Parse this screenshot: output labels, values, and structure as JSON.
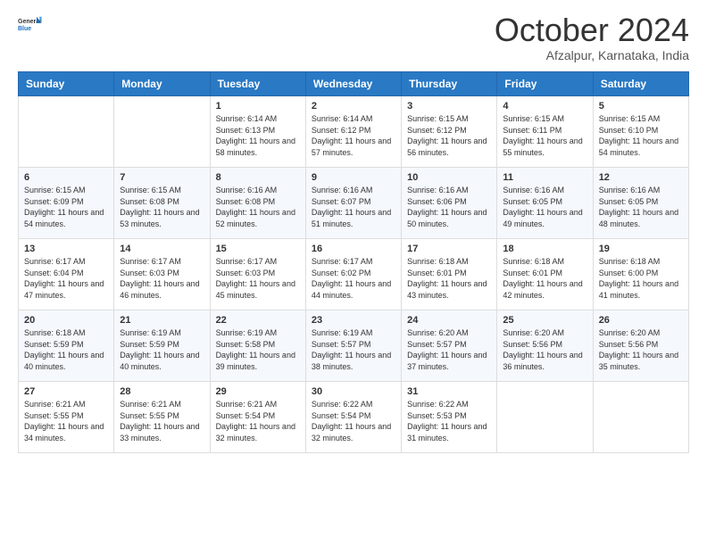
{
  "header": {
    "logo": {
      "general": "General",
      "blue": "Blue"
    },
    "title": "October 2024",
    "location": "Afzalpur, Karnataka, India"
  },
  "calendar": {
    "weekdays": [
      "Sunday",
      "Monday",
      "Tuesday",
      "Wednesday",
      "Thursday",
      "Friday",
      "Saturday"
    ],
    "weeks": [
      [
        {
          "day": "",
          "info": ""
        },
        {
          "day": "",
          "info": ""
        },
        {
          "day": "1",
          "info": "Sunrise: 6:14 AM\nSunset: 6:13 PM\nDaylight: 11 hours and 58 minutes."
        },
        {
          "day": "2",
          "info": "Sunrise: 6:14 AM\nSunset: 6:12 PM\nDaylight: 11 hours and 57 minutes."
        },
        {
          "day": "3",
          "info": "Sunrise: 6:15 AM\nSunset: 6:12 PM\nDaylight: 11 hours and 56 minutes."
        },
        {
          "day": "4",
          "info": "Sunrise: 6:15 AM\nSunset: 6:11 PM\nDaylight: 11 hours and 55 minutes."
        },
        {
          "day": "5",
          "info": "Sunrise: 6:15 AM\nSunset: 6:10 PM\nDaylight: 11 hours and 54 minutes."
        }
      ],
      [
        {
          "day": "6",
          "info": "Sunrise: 6:15 AM\nSunset: 6:09 PM\nDaylight: 11 hours and 54 minutes."
        },
        {
          "day": "7",
          "info": "Sunrise: 6:15 AM\nSunset: 6:08 PM\nDaylight: 11 hours and 53 minutes."
        },
        {
          "day": "8",
          "info": "Sunrise: 6:16 AM\nSunset: 6:08 PM\nDaylight: 11 hours and 52 minutes."
        },
        {
          "day": "9",
          "info": "Sunrise: 6:16 AM\nSunset: 6:07 PM\nDaylight: 11 hours and 51 minutes."
        },
        {
          "day": "10",
          "info": "Sunrise: 6:16 AM\nSunset: 6:06 PM\nDaylight: 11 hours and 50 minutes."
        },
        {
          "day": "11",
          "info": "Sunrise: 6:16 AM\nSunset: 6:05 PM\nDaylight: 11 hours and 49 minutes."
        },
        {
          "day": "12",
          "info": "Sunrise: 6:16 AM\nSunset: 6:05 PM\nDaylight: 11 hours and 48 minutes."
        }
      ],
      [
        {
          "day": "13",
          "info": "Sunrise: 6:17 AM\nSunset: 6:04 PM\nDaylight: 11 hours and 47 minutes."
        },
        {
          "day": "14",
          "info": "Sunrise: 6:17 AM\nSunset: 6:03 PM\nDaylight: 11 hours and 46 minutes."
        },
        {
          "day": "15",
          "info": "Sunrise: 6:17 AM\nSunset: 6:03 PM\nDaylight: 11 hours and 45 minutes."
        },
        {
          "day": "16",
          "info": "Sunrise: 6:17 AM\nSunset: 6:02 PM\nDaylight: 11 hours and 44 minutes."
        },
        {
          "day": "17",
          "info": "Sunrise: 6:18 AM\nSunset: 6:01 PM\nDaylight: 11 hours and 43 minutes."
        },
        {
          "day": "18",
          "info": "Sunrise: 6:18 AM\nSunset: 6:01 PM\nDaylight: 11 hours and 42 minutes."
        },
        {
          "day": "19",
          "info": "Sunrise: 6:18 AM\nSunset: 6:00 PM\nDaylight: 11 hours and 41 minutes."
        }
      ],
      [
        {
          "day": "20",
          "info": "Sunrise: 6:18 AM\nSunset: 5:59 PM\nDaylight: 11 hours and 40 minutes."
        },
        {
          "day": "21",
          "info": "Sunrise: 6:19 AM\nSunset: 5:59 PM\nDaylight: 11 hours and 40 minutes."
        },
        {
          "day": "22",
          "info": "Sunrise: 6:19 AM\nSunset: 5:58 PM\nDaylight: 11 hours and 39 minutes."
        },
        {
          "day": "23",
          "info": "Sunrise: 6:19 AM\nSunset: 5:57 PM\nDaylight: 11 hours and 38 minutes."
        },
        {
          "day": "24",
          "info": "Sunrise: 6:20 AM\nSunset: 5:57 PM\nDaylight: 11 hours and 37 minutes."
        },
        {
          "day": "25",
          "info": "Sunrise: 6:20 AM\nSunset: 5:56 PM\nDaylight: 11 hours and 36 minutes."
        },
        {
          "day": "26",
          "info": "Sunrise: 6:20 AM\nSunset: 5:56 PM\nDaylight: 11 hours and 35 minutes."
        }
      ],
      [
        {
          "day": "27",
          "info": "Sunrise: 6:21 AM\nSunset: 5:55 PM\nDaylight: 11 hours and 34 minutes."
        },
        {
          "day": "28",
          "info": "Sunrise: 6:21 AM\nSunset: 5:55 PM\nDaylight: 11 hours and 33 minutes."
        },
        {
          "day": "29",
          "info": "Sunrise: 6:21 AM\nSunset: 5:54 PM\nDaylight: 11 hours and 32 minutes."
        },
        {
          "day": "30",
          "info": "Sunrise: 6:22 AM\nSunset: 5:54 PM\nDaylight: 11 hours and 32 minutes."
        },
        {
          "day": "31",
          "info": "Sunrise: 6:22 AM\nSunset: 5:53 PM\nDaylight: 11 hours and 31 minutes."
        },
        {
          "day": "",
          "info": ""
        },
        {
          "day": "",
          "info": ""
        }
      ]
    ]
  }
}
